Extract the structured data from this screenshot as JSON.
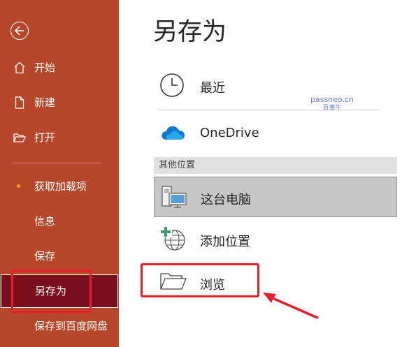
{
  "sidebar": {
    "back_label": "",
    "items": [
      {
        "label": "开始",
        "icon": "home-icon"
      },
      {
        "label": "新建",
        "icon": "new-document-icon"
      },
      {
        "label": "打开",
        "icon": "open-folder-icon"
      },
      {
        "label": "获取加载项",
        "icon": "dot-icon"
      },
      {
        "label": "信息",
        "icon": ""
      },
      {
        "label": "保存",
        "icon": ""
      },
      {
        "label": "另存为",
        "icon": "",
        "active": true
      },
      {
        "label": "保存到百度网盘",
        "icon": ""
      }
    ]
  },
  "main": {
    "title": "另存为",
    "locations": [
      {
        "label": "最近",
        "icon": "clock-icon"
      },
      {
        "label": "OneDrive",
        "icon": "onedrive-cloud-icon"
      }
    ],
    "section_header": "其他位置",
    "other_locations": [
      {
        "label": "这台电脑",
        "icon": "computer-icon",
        "selected": true
      },
      {
        "label": "添加位置",
        "icon": "add-location-globe-icon"
      },
      {
        "label": "浏览",
        "icon": "folder-icon"
      }
    ]
  },
  "watermark": {
    "line1": "passneo.cn",
    "line2": "百事牛"
  },
  "colors": {
    "sidebar_bg": "#b7472a",
    "active_bg": "#7a0f1e",
    "highlight_red": "#e5202a",
    "onedrive_blue": "#0f78d4"
  }
}
